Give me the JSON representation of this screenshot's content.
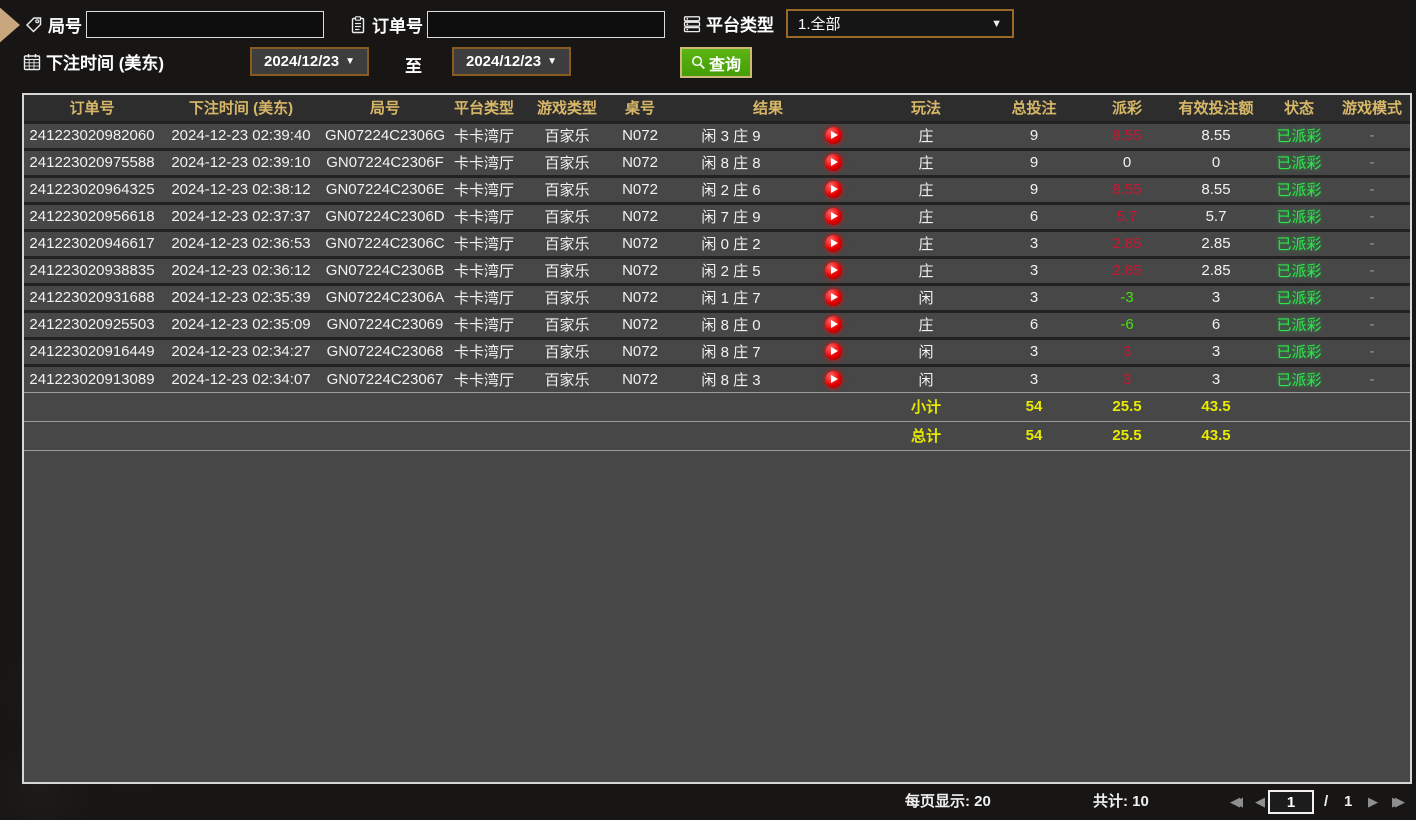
{
  "filters": {
    "round_label": "局号",
    "round_value": "",
    "order_label": "订单号",
    "order_value": "",
    "platform_label": "平台类型",
    "platform_value": "1.全部",
    "bet_time_label": "下注时间 (美东)",
    "date_from": "2024/12/23",
    "to_label": "至",
    "date_to": "2024/12/23",
    "query_label": "查询"
  },
  "table": {
    "headers": [
      "订单号",
      "下注时间 (美东)",
      "局号",
      "平台类型",
      "游戏类型",
      "桌号",
      "结果",
      "玩法",
      "总投注",
      "派彩",
      "有效投注额",
      "状态",
      "游戏模式"
    ],
    "rows": [
      {
        "order": "241223020982060",
        "time": "2024-12-23 02:39:40",
        "round": "GN07224C2306G",
        "platform": "卡卡湾厅",
        "game": "百家乐",
        "table_no": "N072",
        "result": "闲 3 庄 9",
        "play_type": "庄",
        "total_bet": "9",
        "payout": "8.55",
        "payout_color": "red",
        "valid_bet": "8.55",
        "status": "已派彩",
        "mode": "-"
      },
      {
        "order": "241223020975588",
        "time": "2024-12-23 02:39:10",
        "round": "GN07224C2306F",
        "platform": "卡卡湾厅",
        "game": "百家乐",
        "table_no": "N072",
        "result": "闲 8 庄 8",
        "play_type": "庄",
        "total_bet": "9",
        "payout": "0",
        "payout_color": "plain",
        "valid_bet": "0",
        "status": "已派彩",
        "mode": "-"
      },
      {
        "order": "241223020964325",
        "time": "2024-12-23 02:38:12",
        "round": "GN07224C2306E",
        "platform": "卡卡湾厅",
        "game": "百家乐",
        "table_no": "N072",
        "result": "闲 2 庄 6",
        "play_type": "庄",
        "total_bet": "9",
        "payout": "8.55",
        "payout_color": "red",
        "valid_bet": "8.55",
        "status": "已派彩",
        "mode": "-"
      },
      {
        "order": "241223020956618",
        "time": "2024-12-23 02:37:37",
        "round": "GN07224C2306D",
        "platform": "卡卡湾厅",
        "game": "百家乐",
        "table_no": "N072",
        "result": "闲 7 庄 9",
        "play_type": "庄",
        "total_bet": "6",
        "payout": "5.7",
        "payout_color": "red",
        "valid_bet": "5.7",
        "status": "已派彩",
        "mode": "-"
      },
      {
        "order": "241223020946617",
        "time": "2024-12-23 02:36:53",
        "round": "GN07224C2306C",
        "platform": "卡卡湾厅",
        "game": "百家乐",
        "table_no": "N072",
        "result": "闲 0 庄 2",
        "play_type": "庄",
        "total_bet": "3",
        "payout": "2.85",
        "payout_color": "red",
        "valid_bet": "2.85",
        "status": "已派彩",
        "mode": "-"
      },
      {
        "order": "241223020938835",
        "time": "2024-12-23 02:36:12",
        "round": "GN07224C2306B",
        "platform": "卡卡湾厅",
        "game": "百家乐",
        "table_no": "N072",
        "result": "闲 2 庄 5",
        "play_type": "庄",
        "total_bet": "3",
        "payout": "2.85",
        "payout_color": "red",
        "valid_bet": "2.85",
        "status": "已派彩",
        "mode": "-"
      },
      {
        "order": "241223020931688",
        "time": "2024-12-23 02:35:39",
        "round": "GN07224C2306A",
        "platform": "卡卡湾厅",
        "game": "百家乐",
        "table_no": "N072",
        "result": "闲 1 庄 7",
        "play_type": "闲",
        "total_bet": "3",
        "payout": "-3",
        "payout_color": "green",
        "valid_bet": "3",
        "status": "已派彩",
        "mode": "-"
      },
      {
        "order": "241223020925503",
        "time": "2024-12-23 02:35:09",
        "round": "GN07224C23069",
        "platform": "卡卡湾厅",
        "game": "百家乐",
        "table_no": "N072",
        "result": "闲 8 庄 0",
        "play_type": "庄",
        "total_bet": "6",
        "payout": "-6",
        "payout_color": "green",
        "valid_bet": "6",
        "status": "已派彩",
        "mode": "-"
      },
      {
        "order": "241223020916449",
        "time": "2024-12-23 02:34:27",
        "round": "GN07224C23068",
        "platform": "卡卡湾厅",
        "game": "百家乐",
        "table_no": "N072",
        "result": "闲 8 庄 7",
        "play_type": "闲",
        "total_bet": "3",
        "payout": "3",
        "payout_color": "red",
        "valid_bet": "3",
        "status": "已派彩",
        "mode": "-"
      },
      {
        "order": "241223020913089",
        "time": "2024-12-23 02:34:07",
        "round": "GN07224C23067",
        "platform": "卡卡湾厅",
        "game": "百家乐",
        "table_no": "N072",
        "result": "闲 8 庄 3",
        "play_type": "闲",
        "total_bet": "3",
        "payout": "3",
        "payout_color": "red",
        "valid_bet": "3",
        "status": "已派彩",
        "mode": "-"
      }
    ],
    "subtotal": {
      "label": "小计",
      "total_bet": "54",
      "payout": "25.5",
      "valid_bet": "43.5"
    },
    "total": {
      "label": "总计",
      "total_bet": "54",
      "payout": "25.5",
      "valid_bet": "43.5"
    }
  },
  "footer": {
    "per_page_label": "每页显示:",
    "per_page_value": "20",
    "total_label": "共计:",
    "total_value": "10",
    "current_page": "1",
    "page_separator": "/",
    "total_pages": "1"
  },
  "colors": {
    "header_gold": "#d8b868",
    "payout_red": "#c91632",
    "payout_green": "#46e10c",
    "status_green": "#2fe54a",
    "totals_yellow": "#e8ea00",
    "query_button_green": "#4aa00e",
    "date_border_brown": "#8a5a20",
    "row_bg": "#474747",
    "header_bg": "#2d2d2d"
  }
}
